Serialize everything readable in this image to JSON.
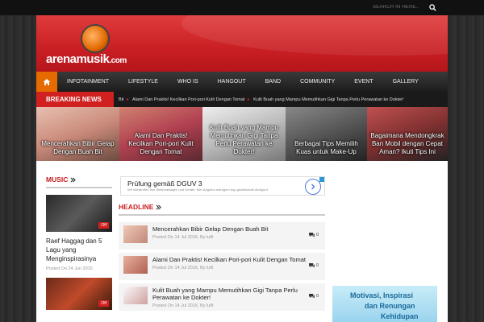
{
  "top_bar": {
    "search_placeholder": "SEARCH IN HERE..."
  },
  "header": {
    "logo_text": "arenamusik",
    "logo_suffix": ".com"
  },
  "nav": {
    "items": [
      "INFOTAINMENT",
      "LIFESTYLE",
      "WHO IS",
      "HANGOUT",
      "BAND",
      "COMMUNITY",
      "EVENT",
      "GALLERY"
    ]
  },
  "breaking": {
    "label": "BREAKING NEWS",
    "items": [
      "Bit",
      "Alami Dan Praktis! Kecilkan Pori-pori Kulit Dengan Tomat",
      "Kulit Buah yang Mampu Memutihkan Gigi Tanpa Perlu Perawatan ke Dokter!"
    ]
  },
  "slider": [
    {
      "caption": "Mencerahkan Bibir Gelap Dengan Buah Bit"
    },
    {
      "caption": "Alami Dan Praktis! Kecilkan Pori-pori Kulit Dengan Tomat"
    },
    {
      "caption": "Kulit Buah yang Mampu Memutihkan Gigi Tanpa Perlu Perawatan ke Dokter!"
    },
    {
      "caption": "Berbagai Tips Memilih Kuas untuk Make-Up"
    },
    {
      "caption": "Bagaimana Mendongkrak Ban Mobil dengan Cepat Aman? Ikuti Tips Ini"
    }
  ],
  "music": {
    "title": "MUSIC",
    "badge": "Off",
    "post_title": "Raef Haggag dan 5 Lagu yang Menginspirasinya",
    "post_date": "Posted On 24 Jun 2016",
    "badge2": "Off"
  },
  "ad": {
    "title": "Prüfung gemäß DGUV 3",
    "subtitle": "Wir überprüfen Ihre Elektroanlagen und Geräte. Hier Angebot anfragen! esp-gesellschaft.de/dguv3"
  },
  "headline": {
    "title": "HEADLINE",
    "items": [
      {
        "title": "Mencerahkan Bibir Gelap Dengan Buah Bit",
        "meta": "Posted On 14 Jul 2016, By lutfi",
        "count": "0"
      },
      {
        "title": "Alami Dan Praktis! Kecilkan Pori-pori Kulit Dengan Tomat",
        "meta": "Posted On 14 Jul 2016, By lutfi",
        "count": "0"
      },
      {
        "title": "Kulit Buah yang Mampu Memutihkan Gigi Tanpa Perlu Perawatan ke Dokter!",
        "meta": "Posted On 14 Jul 2016, By lutfi",
        "count": "0"
      }
    ]
  },
  "right_ad": {
    "line1": "Motivasi, Inspirasi",
    "line2": "dan Renungan",
    "line3": "Kehidupan"
  },
  "colors": {
    "accent_red": "#c81e1e",
    "home_orange": "#e56a00"
  }
}
